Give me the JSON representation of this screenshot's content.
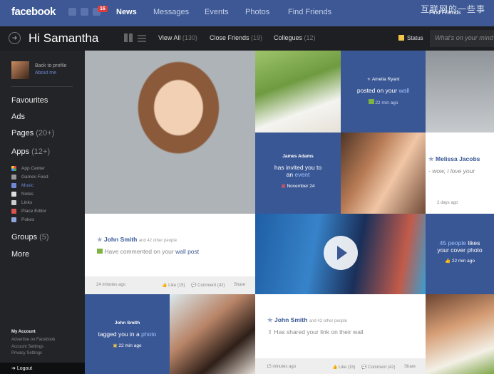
{
  "header": {
    "logo": "facebook",
    "notification_count": "16",
    "nav": [
      "News",
      "Messages",
      "Events",
      "Photos",
      "Find Friends"
    ],
    "watermark": "互联网的一些事",
    "watermark_sub": "Find Friends"
  },
  "subheader": {
    "greeting": "Hi Samantha",
    "tabs": [
      {
        "label": "View All",
        "count": "(130)"
      },
      {
        "label": "Close Friends",
        "count": "(19)"
      },
      {
        "label": "Collegues",
        "count": "(12)"
      }
    ],
    "status_label": "Status",
    "status_placeholder": "What's on your mind"
  },
  "sidebar": {
    "back_to_profile": "Back to profile",
    "about_me": "About me",
    "items_top": [
      {
        "label": "Favourites",
        "count": ""
      },
      {
        "label": "Ads",
        "count": ""
      },
      {
        "label": "Pages",
        "count": "(20+)"
      },
      {
        "label": "Apps",
        "count": "(12+)"
      }
    ],
    "apps": [
      "App Center",
      "Games Feed",
      "Music",
      "Notes",
      "Links",
      "Place Editor",
      "Pokes"
    ],
    "items_bottom": [
      {
        "label": "Groups",
        "count": "(5)"
      },
      {
        "label": "More",
        "count": ""
      }
    ],
    "footer": [
      "My Account",
      "Advertise on Facebook",
      "Account Settings",
      "Privacy Settings"
    ],
    "logout": "Logout"
  },
  "feed": {
    "amelia": {
      "name": "Amelia Ryant",
      "text": "posted on your",
      "link": "wall",
      "time": "22 min ago"
    },
    "james": {
      "name": "James Adams",
      "text": "has invited you to",
      "text2": "an",
      "link": "event",
      "date": "November 24"
    },
    "melissa": {
      "name": "Melissa Jacobs",
      "text": "- wow, i love your",
      "time": "2 days ago"
    },
    "john1": {
      "name": "John Smith",
      "others": "and 42 other people",
      "text": "Have commented on your",
      "link": "wall post",
      "time": "24 minutes ago",
      "like": "Like (15)",
      "comment": "Comment (42)",
      "share": "Share"
    },
    "people45": {
      "count": "45 people",
      "text": "likes",
      "text2": "your cover photo",
      "time": "22 min ago"
    },
    "john2": {
      "name": "John Smith",
      "text": "tagged you in a",
      "link": "photo",
      "time": "22 min ago"
    },
    "john3": {
      "name": "John Smith",
      "others": "and 42 other people",
      "text": "Has shared your link on their wall",
      "time": "15 minutes ago",
      "like": "Like (15)",
      "comment": "Comment (42)",
      "share": "Share"
    }
  }
}
